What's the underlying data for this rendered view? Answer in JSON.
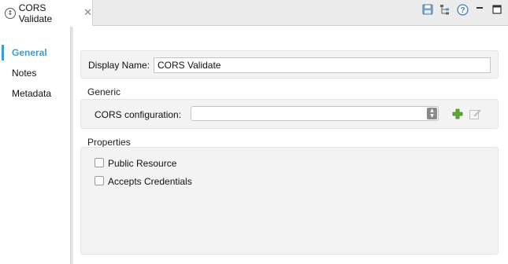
{
  "tab": {
    "title": "CORS Validate",
    "icon": "message-processor-icon",
    "close_glyph": "✕"
  },
  "toolbar": {
    "icons": [
      "save-icon",
      "tree-icon",
      "help-icon",
      "minimize-icon",
      "maximize-icon"
    ]
  },
  "nav": {
    "items": [
      {
        "label": "General",
        "active": true
      },
      {
        "label": "Notes",
        "active": false
      },
      {
        "label": "Metadata",
        "active": false
      }
    ]
  },
  "form": {
    "display_name_label": "Display Name:",
    "display_name_value": "CORS Validate",
    "generic_section": "Generic",
    "cors_config_label": "CORS configuration:",
    "cors_config_value": "",
    "properties_section": "Properties",
    "checkboxes": [
      {
        "label": "Public Resource",
        "checked": false
      },
      {
        "label": "Accepts Credentials",
        "checked": false
      }
    ]
  },
  "colors": {
    "accent": "#3d9bd6",
    "add_green": "#5aa832",
    "panel_bg": "#f3f3f3"
  }
}
